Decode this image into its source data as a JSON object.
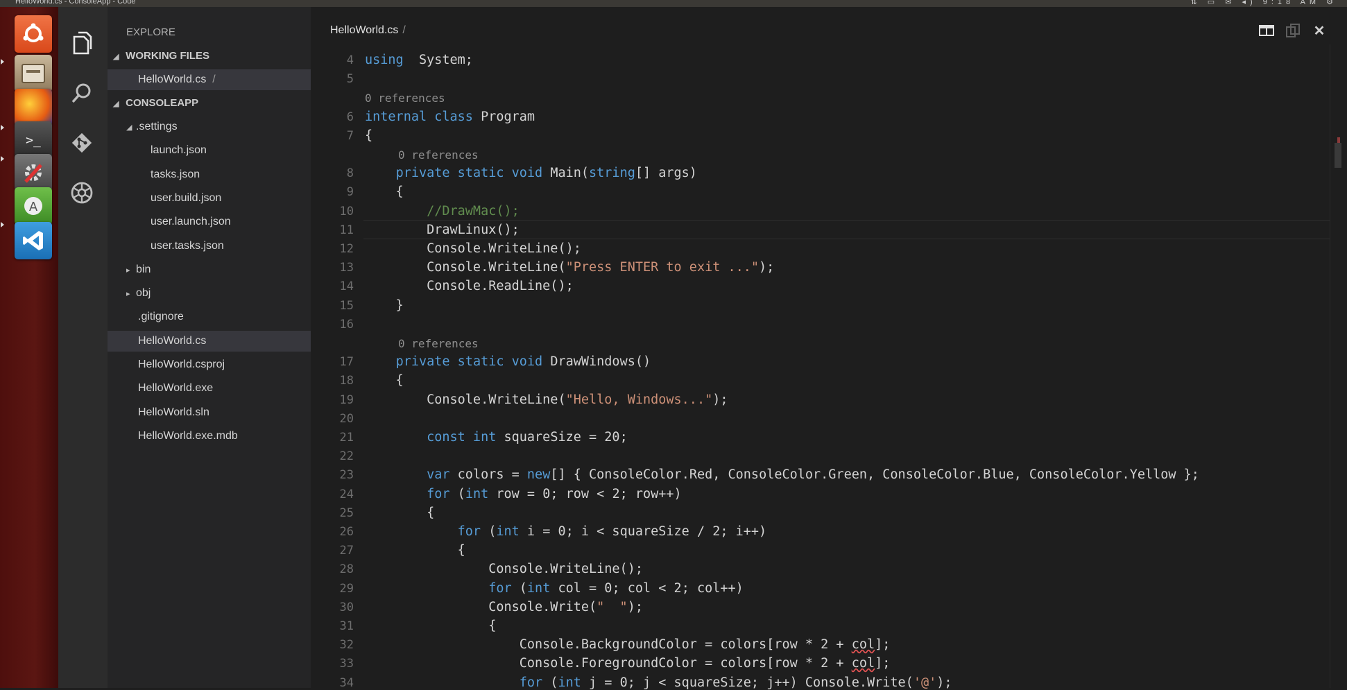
{
  "window": {
    "title": "HelloWorld.cs - ConsoleApp - Code"
  },
  "topbar": {
    "time": "9:18 AM"
  },
  "launcher": {
    "apps": [
      {
        "name": "ubuntu-dash-icon"
      },
      {
        "name": "files-icon"
      },
      {
        "name": "firefox-icon"
      },
      {
        "name": "terminal-icon"
      },
      {
        "name": "system-settings-icon"
      },
      {
        "name": "software-updater-icon"
      },
      {
        "name": "vscode-icon"
      }
    ]
  },
  "activity_bar": {
    "items": [
      "explorer-icon",
      "search-icon",
      "git-icon",
      "debug-icon"
    ]
  },
  "sidebar": {
    "title": "EXPLORE",
    "working_files_header": "WORKING FILES",
    "working_files": [
      {
        "label": "HelloWorld.cs",
        "suffix": "/"
      }
    ],
    "project_header": "CONSOLEAPP",
    "tree": [
      {
        "label": ".settings",
        "arrow": "◢",
        "level": 1
      },
      {
        "label": "launch.json",
        "level": 2
      },
      {
        "label": "tasks.json",
        "level": 2
      },
      {
        "label": "user.build.json",
        "level": 2
      },
      {
        "label": "user.launch.json",
        "level": 2
      },
      {
        "label": "user.tasks.json",
        "level": 2
      },
      {
        "label": "bin",
        "arrow": "▸",
        "level": 1
      },
      {
        "label": "obj",
        "arrow": "▸",
        "level": 1
      },
      {
        "label": ".gitignore",
        "level": 1
      },
      {
        "label": "HelloWorld.cs",
        "level": 1,
        "selected": true
      },
      {
        "label": "HelloWorld.csproj",
        "level": 1
      },
      {
        "label": "HelloWorld.exe",
        "level": 1
      },
      {
        "label": "HelloWorld.sln",
        "level": 1
      },
      {
        "label": "HelloWorld.exe.mdb",
        "level": 1
      }
    ]
  },
  "editor": {
    "tab": {
      "label": "HelloWorld.cs",
      "suffix": "/"
    },
    "controls": [
      "split-editor-icon",
      "open-changes-icon",
      "close-icon"
    ],
    "lines": [
      {
        "n": "4",
        "segs": [
          [
            "kw",
            "using"
          ],
          [
            "",
            "  System;"
          ]
        ]
      },
      {
        "n": "5",
        "segs": []
      },
      {
        "ref": "0 references"
      },
      {
        "n": "6",
        "segs": [
          [
            "kw",
            "internal class"
          ],
          [
            "",
            " Program"
          ]
        ]
      },
      {
        "n": "7",
        "segs": [
          [
            "",
            "{"
          ]
        ]
      },
      {
        "ref": "0 references",
        "indent": 1
      },
      {
        "n": "8",
        "segs": [
          [
            "",
            "    "
          ],
          [
            "kw",
            "private static void"
          ],
          [
            "",
            " Main("
          ],
          [
            "kw",
            "string"
          ],
          [
            "",
            "[] args)"
          ]
        ]
      },
      {
        "n": "9",
        "segs": [
          [
            "",
            "    {"
          ]
        ]
      },
      {
        "n": "10",
        "segs": [
          [
            "",
            "        "
          ],
          [
            "cm",
            "//DrawMac();"
          ]
        ]
      },
      {
        "n": "11",
        "segs": [
          [
            "",
            "        DrawLinux();"
          ]
        ],
        "current": true
      },
      {
        "n": "12",
        "segs": [
          [
            "",
            "        Console.WriteLine();"
          ]
        ]
      },
      {
        "n": "13",
        "segs": [
          [
            "",
            "        Console.WriteLine("
          ],
          [
            "str",
            "\"Press ENTER to exit ...\""
          ],
          [
            "",
            ");"
          ]
        ]
      },
      {
        "n": "14",
        "segs": [
          [
            "",
            "        Console.ReadLine();"
          ]
        ]
      },
      {
        "n": "15",
        "segs": [
          [
            "",
            "    }"
          ]
        ]
      },
      {
        "n": "16",
        "segs": []
      },
      {
        "ref": "0 references",
        "indent": 1
      },
      {
        "n": "17",
        "segs": [
          [
            "",
            "    "
          ],
          [
            "kw",
            "private static void"
          ],
          [
            "",
            " DrawWindows()"
          ]
        ]
      },
      {
        "n": "18",
        "segs": [
          [
            "",
            "    {"
          ]
        ]
      },
      {
        "n": "19",
        "segs": [
          [
            "",
            "        Console.WriteLine("
          ],
          [
            "str",
            "\"Hello, Windows...\""
          ],
          [
            "",
            ");"
          ]
        ]
      },
      {
        "n": "20",
        "segs": []
      },
      {
        "n": "21",
        "segs": [
          [
            "",
            "        "
          ],
          [
            "kw",
            "const int"
          ],
          [
            "",
            " squareSize = 20;"
          ]
        ]
      },
      {
        "n": "22",
        "segs": []
      },
      {
        "n": "23",
        "segs": [
          [
            "",
            "        "
          ],
          [
            "kw",
            "var"
          ],
          [
            "",
            " colors = "
          ],
          [
            "kw",
            "new"
          ],
          [
            "",
            "[] { ConsoleColor.Red, ConsoleColor.Green, ConsoleColor.Blue, ConsoleColor.Yellow };"
          ]
        ]
      },
      {
        "n": "24",
        "segs": [
          [
            "",
            "        "
          ],
          [
            "kw",
            "for"
          ],
          [
            "",
            " ("
          ],
          [
            "kw",
            "int"
          ],
          [
            "",
            " row = 0; row < 2; row++)"
          ]
        ]
      },
      {
        "n": "25",
        "segs": [
          [
            "",
            "        {"
          ]
        ]
      },
      {
        "n": "26",
        "segs": [
          [
            "",
            "            "
          ],
          [
            "kw",
            "for"
          ],
          [
            "",
            " ("
          ],
          [
            "kw",
            "int"
          ],
          [
            "",
            " i = 0; i < squareSize / 2; i++)"
          ]
        ]
      },
      {
        "n": "27",
        "segs": [
          [
            "",
            "            {"
          ]
        ]
      },
      {
        "n": "28",
        "segs": [
          [
            "",
            "                Console.WriteLine();"
          ]
        ]
      },
      {
        "n": "29",
        "segs": [
          [
            "",
            "                "
          ],
          [
            "kw",
            "for"
          ],
          [
            "",
            " ("
          ],
          [
            "kw",
            "int"
          ],
          [
            "",
            " col = 0; col < 2; col++)"
          ]
        ]
      },
      {
        "n": "30",
        "segs": [
          [
            "",
            "                Console.Write("
          ],
          [
            "str",
            "\"  \""
          ],
          [
            "",
            ");"
          ]
        ]
      },
      {
        "n": "31",
        "segs": [
          [
            "",
            "                {"
          ]
        ]
      },
      {
        "n": "32",
        "segs": [
          [
            "",
            "                    Console.BackgroundColor = colors[row * 2 + "
          ],
          [
            "squig",
            "col"
          ],
          [
            "",
            "];"
          ]
        ]
      },
      {
        "n": "33",
        "segs": [
          [
            "",
            "                    Console.ForegroundColor = colors[row * 2 + "
          ],
          [
            "squig",
            "col"
          ],
          [
            "",
            "];"
          ]
        ]
      },
      {
        "n": "34",
        "segs": [
          [
            "",
            "                    "
          ],
          [
            "kw",
            "for"
          ],
          [
            "",
            " ("
          ],
          [
            "kw",
            "int"
          ],
          [
            "",
            " j = 0; j < squareSize; j++) Console.Write("
          ],
          [
            "str",
            "'@'"
          ],
          [
            "",
            ");"
          ]
        ]
      }
    ]
  }
}
